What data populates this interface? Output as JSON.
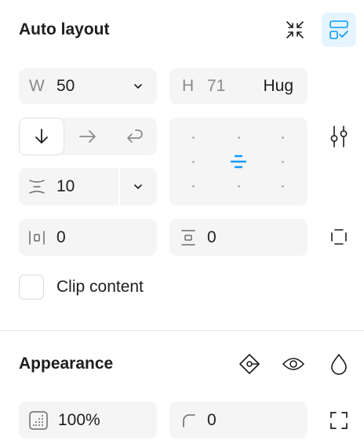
{
  "auto_layout": {
    "title": "Auto layout",
    "width": {
      "prefix": "W",
      "value": "50"
    },
    "height": {
      "prefix": "H",
      "value": "71",
      "mode": "Hug"
    },
    "gap": {
      "value": "10"
    },
    "padding_horizontal": {
      "value": "0"
    },
    "padding_vertical": {
      "value": "0"
    },
    "clip_content_label": "Clip content",
    "clip_content_checked": false,
    "direction_selected": "vertical"
  },
  "appearance": {
    "title": "Appearance",
    "opacity": {
      "value": "100%"
    },
    "corner_radius": {
      "value": "0"
    }
  },
  "colors": {
    "accent": "#0d99ff",
    "field_bg": "#f5f5f5",
    "active_btn_bg": "#e5f4ff"
  }
}
